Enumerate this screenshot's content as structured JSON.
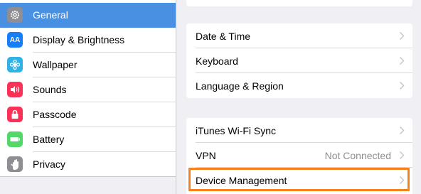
{
  "sidebar": {
    "items": [
      {
        "label": "General",
        "icon": "gear-icon",
        "color": "#8e8e93",
        "active": true
      },
      {
        "label": "Display & Brightness",
        "icon": "display-brightness-icon",
        "color": "#147efb"
      },
      {
        "label": "Wallpaper",
        "icon": "wallpaper-icon",
        "color": "#2fb3e6"
      },
      {
        "label": "Sounds",
        "icon": "speaker-icon",
        "color": "#fc3158"
      },
      {
        "label": "Passcode",
        "icon": "lock-icon",
        "color": "#fc3158"
      },
      {
        "label": "Battery",
        "icon": "battery-icon",
        "color": "#53d769"
      },
      {
        "label": "Privacy",
        "icon": "hand-icon",
        "color": "#8e8e93"
      }
    ]
  },
  "groups": {
    "datetime": {
      "date_time": "Date & Time",
      "keyboard": "Keyboard",
      "language": "Language & Region"
    },
    "network": {
      "itunes": "iTunes Wi-Fi Sync",
      "vpn": "VPN",
      "vpn_status": "Not Connected",
      "device_management": "Device Management"
    }
  },
  "colors": {
    "accent": "#4a90e2",
    "highlight": "#f5821f"
  }
}
